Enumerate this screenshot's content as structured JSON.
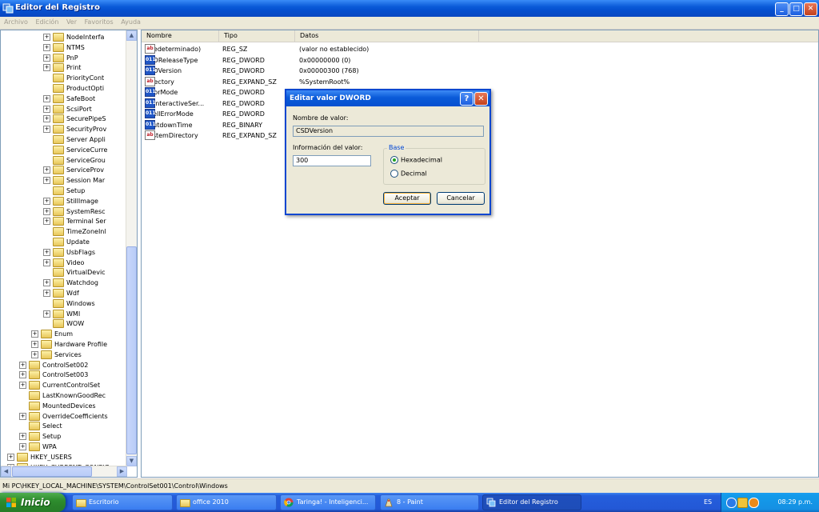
{
  "window": {
    "title": "Editor del Registro",
    "minimize": "_",
    "maximize": "□",
    "close": "✕"
  },
  "menu": [
    "Archivo",
    "Edición",
    "Ver",
    "Favoritos",
    "Ayuda"
  ],
  "tree": {
    "items": [
      {
        "label": "NodeInterfa",
        "depth": 5,
        "expander": "+"
      },
      {
        "label": "NTMS",
        "depth": 5,
        "expander": "+"
      },
      {
        "label": "PnP",
        "depth": 5,
        "expander": "+"
      },
      {
        "label": "Print",
        "depth": 5,
        "expander": "+"
      },
      {
        "label": "PriorityCont",
        "depth": 5,
        "expander": ""
      },
      {
        "label": "ProductOpti",
        "depth": 5,
        "expander": ""
      },
      {
        "label": "SafeBoot",
        "depth": 5,
        "expander": "+"
      },
      {
        "label": "ScsiPort",
        "depth": 5,
        "expander": "+"
      },
      {
        "label": "SecurePipeS",
        "depth": 5,
        "expander": "+"
      },
      {
        "label": "SecurityProv",
        "depth": 5,
        "expander": "+"
      },
      {
        "label": "Server Appli",
        "depth": 5,
        "expander": ""
      },
      {
        "label": "ServiceCurre",
        "depth": 5,
        "expander": ""
      },
      {
        "label": "ServiceGrou",
        "depth": 5,
        "expander": ""
      },
      {
        "label": "ServiceProv",
        "depth": 5,
        "expander": "+"
      },
      {
        "label": "Session Mar",
        "depth": 5,
        "expander": "+"
      },
      {
        "label": "Setup",
        "depth": 5,
        "expander": ""
      },
      {
        "label": "StillImage",
        "depth": 5,
        "expander": "+"
      },
      {
        "label": "SystemResc",
        "depth": 5,
        "expander": "+"
      },
      {
        "label": "Terminal Ser",
        "depth": 5,
        "expander": "+"
      },
      {
        "label": "TimeZoneInl",
        "depth": 5,
        "expander": ""
      },
      {
        "label": "Update",
        "depth": 5,
        "expander": ""
      },
      {
        "label": "UsbFlags",
        "depth": 5,
        "expander": "+"
      },
      {
        "label": "Video",
        "depth": 5,
        "expander": "+"
      },
      {
        "label": "VirtualDevic",
        "depth": 5,
        "expander": ""
      },
      {
        "label": "Watchdog",
        "depth": 5,
        "expander": "+"
      },
      {
        "label": "Wdf",
        "depth": 5,
        "expander": "+"
      },
      {
        "label": "Windows",
        "depth": 5,
        "expander": ""
      },
      {
        "label": "WMI",
        "depth": 5,
        "expander": "+"
      },
      {
        "label": "WOW",
        "depth": 5,
        "expander": ""
      },
      {
        "label": "Enum",
        "depth": 4,
        "expander": "+"
      },
      {
        "label": "Hardware Profile",
        "depth": 4,
        "expander": "+"
      },
      {
        "label": "Services",
        "depth": 4,
        "expander": "+"
      },
      {
        "label": "ControlSet002",
        "depth": 3,
        "expander": "+"
      },
      {
        "label": "ControlSet003",
        "depth": 3,
        "expander": "+"
      },
      {
        "label": "CurrentControlSet",
        "depth": 3,
        "expander": "+"
      },
      {
        "label": "LastKnownGoodRec",
        "depth": 3,
        "expander": ""
      },
      {
        "label": "MountedDevices",
        "depth": 3,
        "expander": ""
      },
      {
        "label": "OverrideCoefficients",
        "depth": 3,
        "expander": "+"
      },
      {
        "label": "Select",
        "depth": 3,
        "expander": ""
      },
      {
        "label": "Setup",
        "depth": 3,
        "expander": "+"
      },
      {
        "label": "WPA",
        "depth": 3,
        "expander": "+"
      },
      {
        "label": "HKEY_USERS",
        "depth": 2,
        "expander": "+"
      },
      {
        "label": "HKEY_CURRENT_CONFIG",
        "depth": 2,
        "expander": "+"
      }
    ]
  },
  "list": {
    "columns": [
      "Nombre",
      "Tipo",
      "Datos"
    ],
    "rows": [
      {
        "icon": "ab",
        "name": "(Predeterminado)",
        "type": "REG_SZ",
        "data": "(valor no establecido)"
      },
      {
        "icon": "bin",
        "name": "CSDReleaseType",
        "type": "REG_DWORD",
        "data": "0x00000000 (0)"
      },
      {
        "icon": "bin",
        "name": "CSDVersion",
        "type": "REG_DWORD",
        "data": "0x00000300 (768)"
      },
      {
        "icon": "ab",
        "name": "Directory",
        "type": "REG_EXPAND_SZ",
        "data": "%SystemRoot%"
      },
      {
        "icon": "bin",
        "name": "ErrorMode",
        "type": "REG_DWORD",
        "data": ""
      },
      {
        "icon": "bin",
        "name": "NoInteractiveSer...",
        "type": "REG_DWORD",
        "data": ""
      },
      {
        "icon": "bin",
        "name": "ShellErrorMode",
        "type": "REG_DWORD",
        "data": ""
      },
      {
        "icon": "bin",
        "name": "ShutdownTime",
        "type": "REG_BINARY",
        "data": ""
      },
      {
        "icon": "ab",
        "name": "SystemDirectory",
        "type": "REG_EXPAND_SZ",
        "data": ""
      }
    ]
  },
  "dialog": {
    "title": "Editar valor DWORD",
    "help": "?",
    "close": "✕",
    "name_label": "Nombre de valor:",
    "name_value": "CSDVersion",
    "data_label": "Información del valor:",
    "data_value": "300",
    "base_label": "Base",
    "hex_label": "Hexadecimal",
    "dec_label": "Decimal",
    "selected_base": "Hexadecimal",
    "ok": "Aceptar",
    "cancel": "Cancelar"
  },
  "statusbar": {
    "path": "Mi PC\\HKEY_LOCAL_MACHINE\\SYSTEM\\ControlSet001\\Control\\Windows"
  },
  "taskbar": {
    "start": "Inicio",
    "tasks": [
      {
        "label": "Escritorio",
        "icon": "folder-icon"
      },
      {
        "label": "office 2010",
        "icon": "folder-icon"
      },
      {
        "label": "Taringa! - Inteligenci...",
        "icon": "chrome-icon"
      },
      {
        "label": "8 - Paint",
        "icon": "paint-icon"
      },
      {
        "label": "Editor del Registro",
        "icon": "regedit-icon",
        "active": true
      }
    ],
    "language": "ES",
    "clock": "08:29 p.m."
  }
}
